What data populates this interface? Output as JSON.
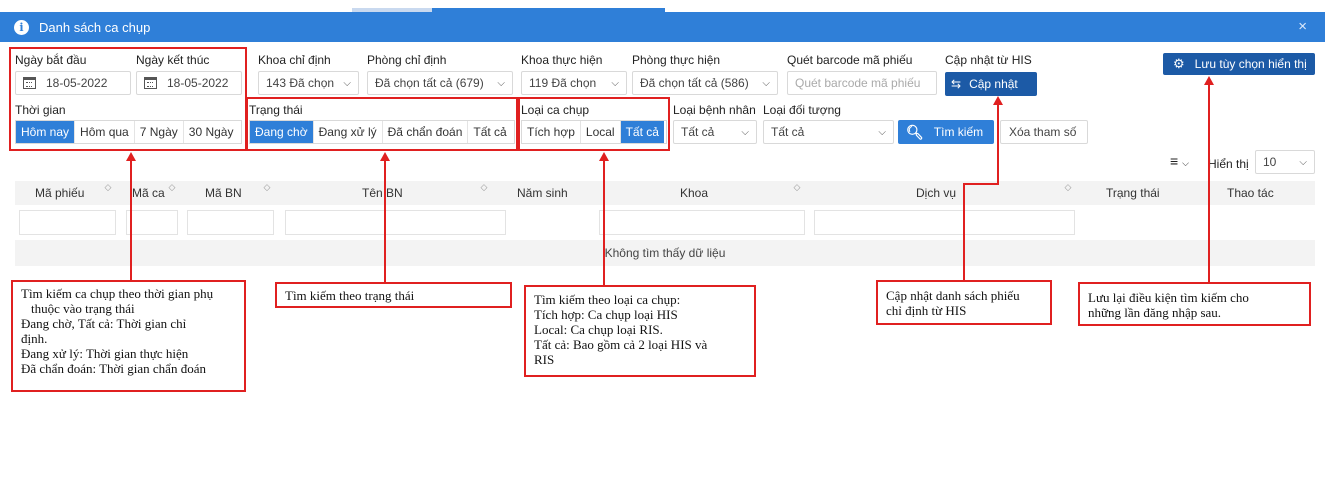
{
  "window": {
    "title": "Danh sách ca chụp",
    "close": "×"
  },
  "filters": {
    "start_date_label": "Ngày bắt đầu",
    "start_date_value": "18-05-2022",
    "end_date_label": "Ngày kết thúc",
    "end_date_value": "18-05-2022",
    "khoa_chi_dinh_label": "Khoa chỉ định",
    "khoa_chi_dinh_value": "143 Đã chọn",
    "phong_chi_dinh_label": "Phòng chỉ định",
    "phong_chi_dinh_value": "Đã chọn tất cả (679)",
    "khoa_thuc_hien_label": "Khoa thực hiện",
    "khoa_thuc_hien_value": "119 Đã chọn",
    "phong_thuc_hien_label": "Phòng thực hiện",
    "phong_thuc_hien_value": "Đã chọn tất cả (586)",
    "barcode_label": "Quét barcode mã phiếu",
    "barcode_placeholder": "Quét barcode mã phiếu",
    "his_label": "Cập nhật từ HIS",
    "his_button": "Cập nhật",
    "save_prefs_button": "Lưu tùy chọn hiển thị",
    "time_label": "Thời gian",
    "time_options": [
      "Hôm nay",
      "Hôm qua",
      "7 Ngày",
      "30 Ngày"
    ],
    "status_label": "Trạng thái",
    "status_options": [
      "Đang chờ",
      "Đang xử lý",
      "Đã chẩn đoán",
      "Tất cả"
    ],
    "type_label": "Loại ca chụp",
    "type_options": [
      "Tích hợp",
      "Local",
      "Tất cả"
    ],
    "patient_type_label": "Loại bệnh nhân",
    "patient_type_value": "Tất cả",
    "object_type_label": "Loại đối tượng",
    "object_type_value": "Tất cả",
    "search_button": "Tìm kiếm",
    "clear_button": "Xóa tham số"
  },
  "list_controls": {
    "display_label": "Hiển thị",
    "page_size": "10"
  },
  "table": {
    "columns": [
      "Mã phiếu",
      "Mã ca",
      "Mã BN",
      "Tên BN",
      "Năm sinh",
      "Khoa",
      "Dịch vụ",
      "Trạng thái",
      "Thao tác"
    ],
    "empty_text": "Không tìm thấy dữ liệu"
  },
  "annotations": {
    "time": [
      "Tìm kiếm ca chụp theo thời gian phụ",
      "thuộc vào trạng thái",
      "Đang chờ, Tất cả: Thời gian chỉ",
      "định.",
      "Đang xử lý: Thời gian thực hiện",
      "Đã chẩn đoán: Thời gian chẩn đoán"
    ],
    "status": [
      "Tìm kiếm theo trạng thái"
    ],
    "type": [
      "Tìm kiếm theo loại ca chụp:",
      "Tích hợp: Ca chụp loại HIS",
      "Local: Ca chụp loại RIS.",
      "Tất cả: Bao gồm cả 2 loại HIS và",
      "RIS"
    ],
    "his": [
      "Cập nhật danh sách phiếu",
      "chỉ định từ HIS"
    ],
    "save": [
      "Lưu lại điều kiện tìm kiếm cho",
      "những lần đăng nhập sau."
    ]
  },
  "colors": {
    "primary": "#2f7fd8",
    "annotation": "#e02020"
  }
}
